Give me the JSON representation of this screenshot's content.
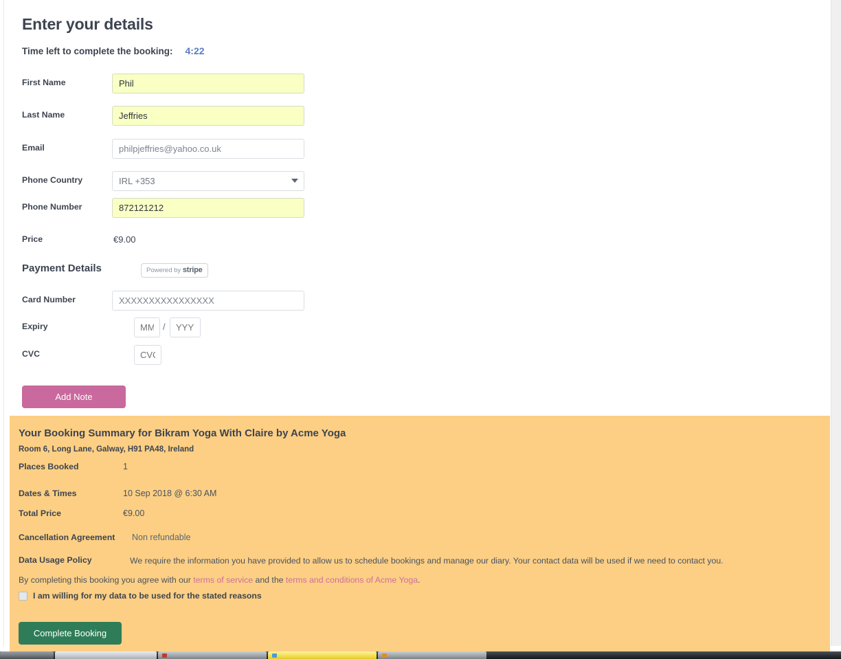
{
  "page": {
    "title": "Enter your details",
    "timer_label": "Time left to complete the booking:",
    "timer_value": "4:22",
    "accent_autofill": "#faffc4",
    "accent_panel": "#fccf84",
    "accent_link": "#cd6f9e",
    "accent_primary": "#2f7d58",
    "accent_secondary": "#c9699d",
    "accent_timer": "#5b7cc4"
  },
  "form": {
    "fields": [
      {
        "label": "First Name",
        "value": "Phil",
        "placeholder": "",
        "type": "text",
        "autofill": true
      },
      {
        "label": "Last Name",
        "value": "Jeffries",
        "placeholder": "",
        "type": "text",
        "autofill": true
      },
      {
        "label": "Email",
        "value": "philpjeffries@yahoo.co.uk",
        "placeholder": "",
        "type": "text",
        "autofill": false
      },
      {
        "label": "Phone Country",
        "value": "IRL +353",
        "placeholder": "",
        "type": "select",
        "autofill": false
      },
      {
        "label": "Phone Number",
        "value": "872121212",
        "placeholder": "",
        "type": "text",
        "autofill": true
      }
    ],
    "price_label": "Price",
    "price_value": "€9.00"
  },
  "payment": {
    "section_title": "Payment Details",
    "stripe_prefix": "Powered by",
    "stripe_brand": "stripe",
    "card_number_label": "Card Number",
    "card_number_value": "XXXXXXXXXXXXXXXX",
    "expiry_label": "Expiry",
    "expiry_month_placeholder": "MM",
    "expiry_separator": "/",
    "expiry_year_placeholder": "YYYY",
    "cvc_label": "CVC",
    "cvc_placeholder": "CVC",
    "add_note_label": "Add Note"
  },
  "summary": {
    "title": "Your Booking Summary for Bikram Yoga With Claire by Acme Yoga",
    "address": "Room 6, Long Lane, Galway, H91 PA48, Ireland",
    "rows": [
      {
        "label": "Places Booked",
        "value": "1"
      },
      {
        "label": "Dates & Times",
        "value": "10 Sep 2018 @ 6:30 AM"
      },
      {
        "label": "Total Price",
        "value": "€9.00"
      },
      {
        "label": "Cancellation Agreement",
        "value": "Non refundable"
      }
    ],
    "policy_label": "Data Usage Policy",
    "policy_text": "We require the information you have provided to allow us to schedule bookings and manage our diary. Your contact data will be used if we need to contact you.",
    "agree_prefix": "By completing this booking you agree with our ",
    "agree_link_1": "terms of service",
    "agree_middle": " and the ",
    "agree_link_2": "terms and conditions of Acme Yoga",
    "agree_suffix": ".",
    "consent_label": "I am willing for my data to be used for the stated reasons",
    "consent_checked": false,
    "complete_label": "Complete Booking"
  }
}
